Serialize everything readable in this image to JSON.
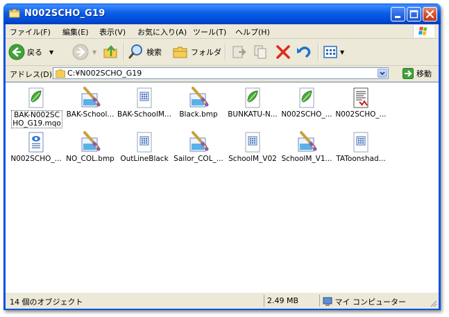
{
  "window": {
    "title": "N002SCHO_G19",
    "colors": {
      "titlebar": "#0054e3",
      "frame": "#ece9d8",
      "close": "#d9532f"
    }
  },
  "menu": {
    "items": [
      {
        "label": "ファイル(F)"
      },
      {
        "label": "編集(E)"
      },
      {
        "label": "表示(V)"
      },
      {
        "label": "お気に入り(A)"
      },
      {
        "label": "ツール(T)"
      },
      {
        "label": "ヘルプ(H)"
      }
    ]
  },
  "toolbar": {
    "back_label": "戻る",
    "search_label": "検索",
    "folders_label": "フォルダ"
  },
  "address": {
    "label": "アドレス(D)",
    "value": "C:¥N002SCHO_G19",
    "go_label": "移動"
  },
  "files": [
    {
      "name": "BAK-N002SCHO_G19.mqo",
      "icon": "mqo-leaf-icon",
      "selected": true
    },
    {
      "name": "BAK-School...",
      "icon": "bmp-paint-icon"
    },
    {
      "name": "BAK-SchoolM...",
      "icon": "generic-file-icon"
    },
    {
      "name": "Black.bmp",
      "icon": "bmp-paint-icon"
    },
    {
      "name": "BUNKATU-N...",
      "icon": "mqo-leaf-icon"
    },
    {
      "name": "N002SCHO_...",
      "icon": "mqo-leaf-icon"
    },
    {
      "name": "N002SCHO_...",
      "icon": "text-doc-icon"
    },
    {
      "name": "N002SCHO_...",
      "icon": "config-file-icon"
    },
    {
      "name": "NO_COL.bmp",
      "icon": "bmp-paint-icon"
    },
    {
      "name": "OutLineBlack",
      "icon": "generic-file-icon"
    },
    {
      "name": "Sailor_COL_...",
      "icon": "bmp-paint-icon"
    },
    {
      "name": "SchoolM_V02",
      "icon": "generic-file-icon"
    },
    {
      "name": "SchoolM_V1...",
      "icon": "bmp-paint-icon"
    },
    {
      "name": "TAToonshad...",
      "icon": "generic-file-icon"
    }
  ],
  "status": {
    "objects": "14 個のオブジェクト",
    "size": "2.49 MB",
    "zone": "マイ コンピューター"
  }
}
